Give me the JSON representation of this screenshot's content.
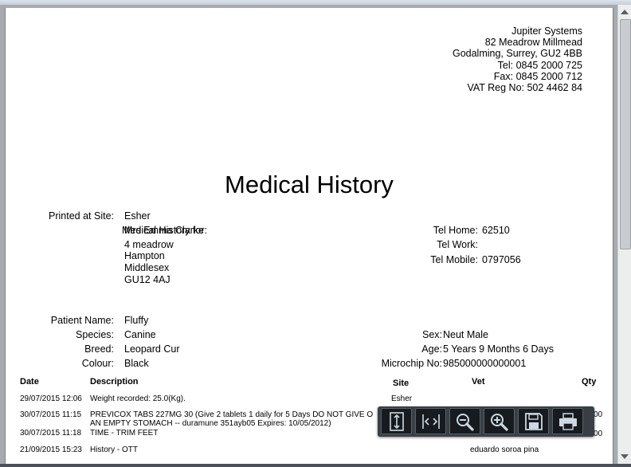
{
  "company": {
    "name": "Jupiter Systems",
    "address_line1": "82 Meadrow Millmead",
    "address_line2": "Godalming, Surrey, GU2 4BB",
    "tel": "Tel: 0845 2000 725",
    "fax": "Fax: 0845 2000 712",
    "vat": "VAT Reg No: 502 4462 84"
  },
  "title": "Medical History",
  "site": {
    "label": "Printed at Site:",
    "value": "Esher"
  },
  "owner": {
    "label": "Medical History for:",
    "name": "Mrs Emma Clarke",
    "address": [
      "4 meadrow",
      "Hampton",
      "Middlesex",
      "GU12 4AJ"
    ]
  },
  "phones": {
    "home_label": "Tel Home:",
    "home": "62510",
    "work_label": "Tel Work:",
    "work": "",
    "mobile_label": "Tel Mobile:",
    "mobile": "0797056"
  },
  "patient": {
    "name_label": "Patient Name:",
    "name": "Fluffy",
    "species_label": "Species:",
    "species": "Canine",
    "breed_label": "Breed:",
    "breed": "Leopard Cur",
    "colour_label": "Colour:",
    "colour": "Black",
    "sex_label": "Sex:",
    "sex": "Neut Male",
    "age_label": "Age:",
    "age": "5 Years 9 Months 6 Days",
    "microchip_label": "Microchip No:",
    "microchip": "985000000000001"
  },
  "table": {
    "headers": {
      "date": "Date",
      "description": "Description",
      "site": "Site",
      "vet": "Vet",
      "qty": "Qty"
    },
    "rows": [
      {
        "date": "29/07/2015 12:06",
        "description": "Weight recorded: 25.0(Kg).",
        "site": "Esher",
        "vet": "",
        "qty": ""
      },
      {
        "date": "30/07/2015 11:15",
        "description": "PREVICOX TABS 227MG 30 (Give 2 tablets 1 daily for 5 Days DO NOT GIVE O",
        "description2": "AN EMPTY STOMACH  -- duramune 351ayb05 Expires: 10/05/2012)",
        "site": "",
        "vet": "",
        "qty": "00"
      },
      {
        "date": "30/07/2015 11:18",
        "description": "TIME - TRIM FEET",
        "site": "",
        "vet": "",
        "qty": "00"
      },
      {
        "date": "21/09/2015 15:23",
        "description": "History - OTT",
        "site": "",
        "vet": "eduardo soroa pina",
        "qty": ""
      }
    ]
  },
  "toolbar": {
    "buttons": [
      "fit-page-icon",
      "fit-width-icon",
      "zoom-out-icon",
      "zoom-in-icon",
      "save-icon",
      "print-icon"
    ]
  }
}
